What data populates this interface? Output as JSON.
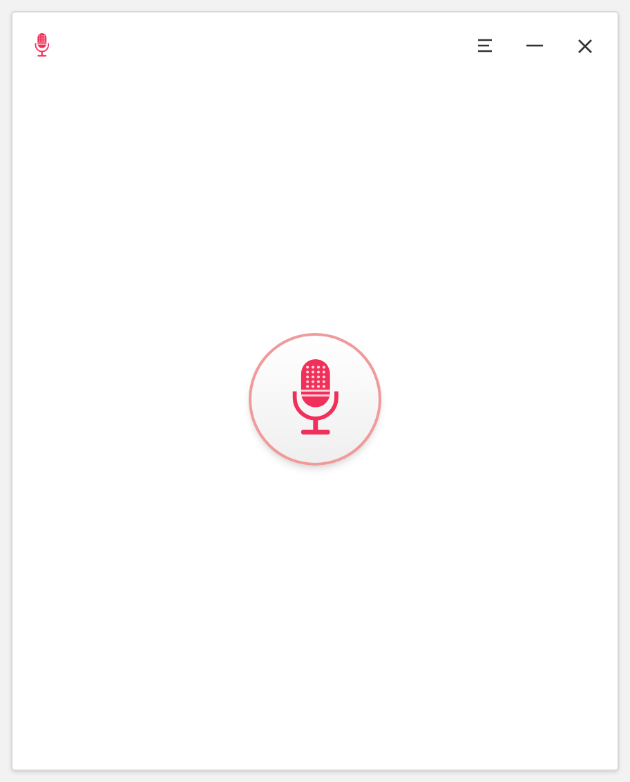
{
  "window": {
    "controls": [
      {
        "kind": "menu"
      },
      {
        "kind": "minimize"
      },
      {
        "kind": "close"
      }
    ]
  }
}
